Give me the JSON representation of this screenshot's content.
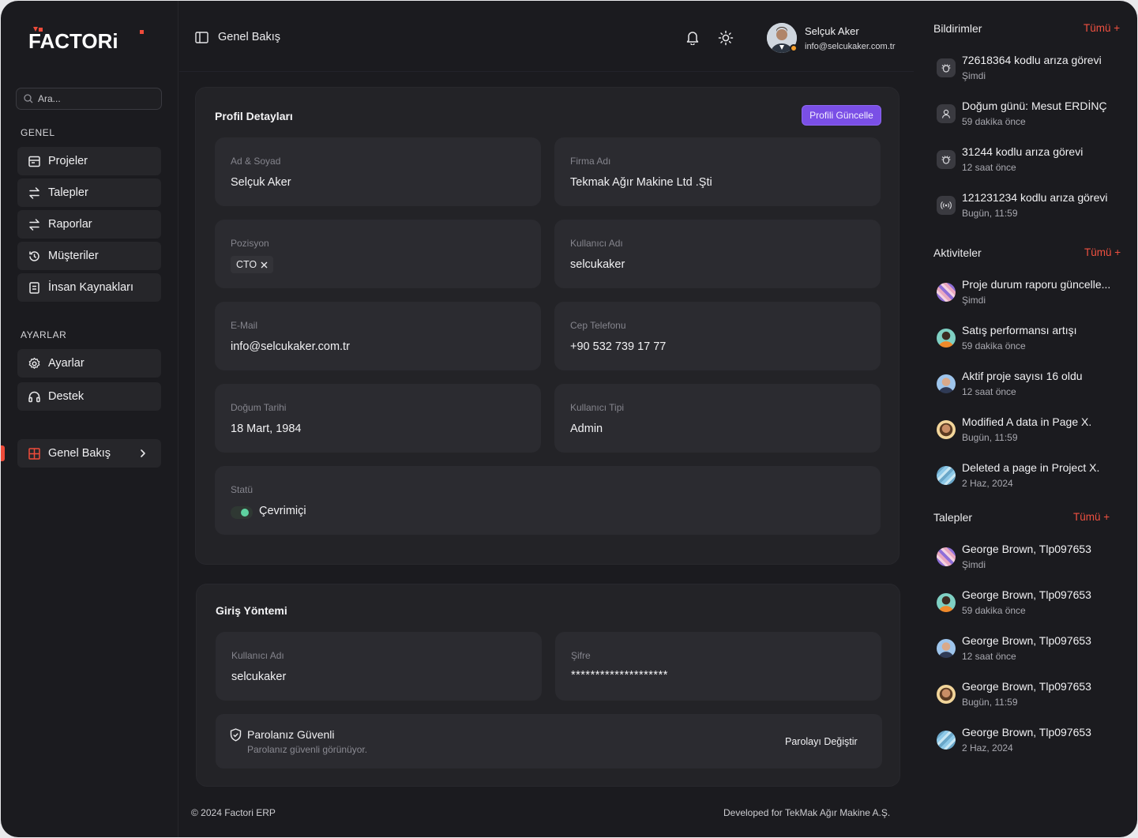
{
  "app": {
    "logo_text": "FACTORi",
    "search_placeholder": "Ara..."
  },
  "sidebar": {
    "section_general": "GENEL",
    "section_settings": "AYARLAR",
    "items": [
      {
        "label": "Projeler",
        "icon": "folder-icon"
      },
      {
        "label": "Talepler",
        "icon": "swap-icon"
      },
      {
        "label": "Raporlar",
        "icon": "swap-icon"
      },
      {
        "label": "Müşteriler",
        "icon": "history-icon"
      },
      {
        "label": "İnsan Kaynakları",
        "icon": "document-icon"
      }
    ],
    "settings_items": [
      {
        "label": "Ayarlar",
        "icon": "gear-icon"
      },
      {
        "label": "Destek",
        "icon": "headset-icon"
      }
    ],
    "active_item": {
      "label": "Genel Bakış",
      "icon": "grid-icon"
    }
  },
  "header": {
    "breadcrumb": "Genel Bakış",
    "user_name": "Selçuk Aker",
    "user_email": "info@selcukaker.com.tr"
  },
  "profile": {
    "title": "Profil Detayları",
    "update_button": "Profili Güncelle",
    "fields": {
      "name": {
        "label": "Ad & Soyad",
        "value": "Selçuk Aker"
      },
      "company": {
        "label": "Firma Adı",
        "value": "Tekmak Ağır Makine Ltd .Şti"
      },
      "position": {
        "label": "Pozisyon",
        "value": "CTO"
      },
      "username": {
        "label": "Kullanıcı Adı",
        "value": "selcukaker"
      },
      "email": {
        "label": "E-Mail",
        "value": "info@selcukaker.com.tr"
      },
      "phone": {
        "label": "Cep Telefonu",
        "value": "+90 532 739 17 77"
      },
      "birthdate": {
        "label": "Doğum Tarihi",
        "value": "18 Mart, 1984"
      },
      "user_type": {
        "label": "Kullanıcı Tipi",
        "value": "Admin"
      },
      "status": {
        "label": "Statü",
        "value": "Çevrimiçi",
        "online": true
      }
    }
  },
  "login": {
    "title": "Giriş Yöntemi",
    "username": {
      "label": "Kullanıcı Adı",
      "value": "selcukaker"
    },
    "password": {
      "label": "Şifre",
      "value": "********************"
    },
    "secure_title": "Parolanız Güvenli",
    "secure_sub": "Parolanız güvenli görünüyor.",
    "change_button": "Parolayı Değiştir"
  },
  "footer": {
    "left": "© 2024 Factori ERP",
    "right": "Developed for TekMak Ağır Makine A.Ş."
  },
  "notifications": {
    "title": "Bildirimler",
    "all": "Tümü +",
    "items": [
      {
        "text": "72618364 kodlu arıza görevi",
        "time": "Şimdi",
        "icon": "bug-icon"
      },
      {
        "text": "Doğum günü: Mesut ERDİNÇ",
        "time": "59 dakika önce",
        "icon": "user-icon"
      },
      {
        "text": "31244 kodlu arıza görevi",
        "time": "12 saat önce",
        "icon": "bug-icon"
      },
      {
        "text": "121231234 kodlu arıza görevi",
        "time": "Bugün, 11:59",
        "icon": "broadcast-icon"
      }
    ]
  },
  "activities": {
    "title": "Aktiviteler",
    "all": "Tümü +",
    "items": [
      {
        "text": "Proje durum raporu güncelle...",
        "time": "Şimdi"
      },
      {
        "text": "Satış performansı artışı",
        "time": "59 dakika önce"
      },
      {
        "text": "Aktif proje sayısı 16 oldu",
        "time": "12 saat önce"
      },
      {
        "text": "Modified A data in Page X.",
        "time": "Bugün, 11:59"
      },
      {
        "text": "Deleted a page in Project X.",
        "time": "2 Haz, 2024"
      }
    ]
  },
  "requests": {
    "title": "Talepler",
    "all": "Tümü +",
    "items": [
      {
        "text": "George Brown, Tlp097653",
        "time": "Şimdi"
      },
      {
        "text": "George Brown, Tlp097653",
        "time": "59 dakika önce"
      },
      {
        "text": "George Brown, Tlp097653",
        "time": "12 saat önce"
      },
      {
        "text": "George Brown, Tlp097653",
        "time": "Bugün, 11:59"
      },
      {
        "text": "George Brown, Tlp097653",
        "time": "2 Haz, 2024"
      }
    ]
  },
  "colors": {
    "accent": "#ef4b3a",
    "primary": "#7a4fe6",
    "online": "#5ed3a0",
    "background": "#1b1b1f",
    "card": "#232327"
  }
}
